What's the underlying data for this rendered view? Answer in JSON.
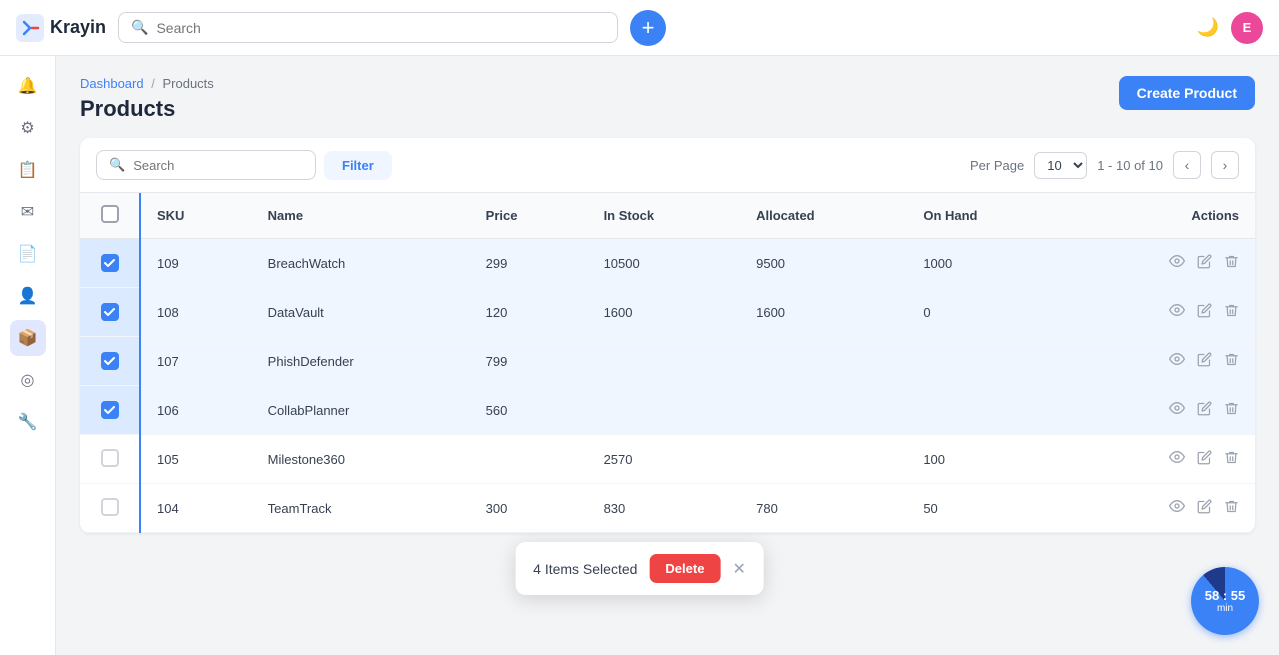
{
  "app": {
    "name": "Krayin",
    "avatar_initials": "E",
    "search_placeholder": "Search"
  },
  "topnav": {
    "add_button_label": "+",
    "page_range": "1 - 10 of 10"
  },
  "breadcrumb": {
    "parent": "Dashboard",
    "separator": "/",
    "current": "Products"
  },
  "page": {
    "title": "Products",
    "create_btn": "Create Product"
  },
  "toolbar": {
    "search_placeholder": "Search",
    "filter_label": "Filter",
    "per_page_label": "Per Page",
    "per_page_value": "10",
    "page_range": "1 - 10 of 10"
  },
  "table": {
    "columns": [
      "SKU",
      "Name",
      "Price",
      "In Stock",
      "Allocated",
      "On Hand",
      "Actions"
    ],
    "rows": [
      {
        "sku": "109",
        "name": "BreachWatch",
        "price": "299",
        "in_stock": "10500",
        "allocated": "9500",
        "on_hand": "1000",
        "selected": true
      },
      {
        "sku": "108",
        "name": "DataVault",
        "price": "120",
        "in_stock": "1600",
        "allocated": "1600",
        "on_hand": "0",
        "selected": true
      },
      {
        "sku": "107",
        "name": "PhishDefender",
        "price": "799",
        "in_stock": "",
        "allocated": "",
        "on_hand": "",
        "selected": true
      },
      {
        "sku": "106",
        "name": "CollabPlanner",
        "price": "560",
        "in_stock": "",
        "allocated": "",
        "on_hand": "",
        "selected": true
      },
      {
        "sku": "105",
        "name": "Milestone360",
        "price": "",
        "in_stock": "2570",
        "allocated": "",
        "on_hand": "100",
        "selected": false
      },
      {
        "sku": "104",
        "name": "TeamTrack",
        "price": "300",
        "in_stock": "830",
        "allocated": "780",
        "on_hand": "50",
        "selected": false
      }
    ]
  },
  "selection_toast": {
    "count_label": "4 Items Selected",
    "delete_label": "Delete"
  },
  "timer": {
    "display": "58 : 55",
    "unit": "min"
  },
  "sidebar": {
    "items": [
      {
        "icon": "🔔",
        "name": "notifications"
      },
      {
        "icon": "⚙",
        "name": "settings"
      },
      {
        "icon": "📋",
        "name": "tasks"
      },
      {
        "icon": "✉",
        "name": "mail"
      },
      {
        "icon": "📄",
        "name": "documents"
      },
      {
        "icon": "👤",
        "name": "contacts"
      },
      {
        "icon": "📦",
        "name": "products",
        "active": true
      },
      {
        "icon": "◎",
        "name": "analytics"
      },
      {
        "icon": "🔧",
        "name": "tools"
      }
    ]
  }
}
